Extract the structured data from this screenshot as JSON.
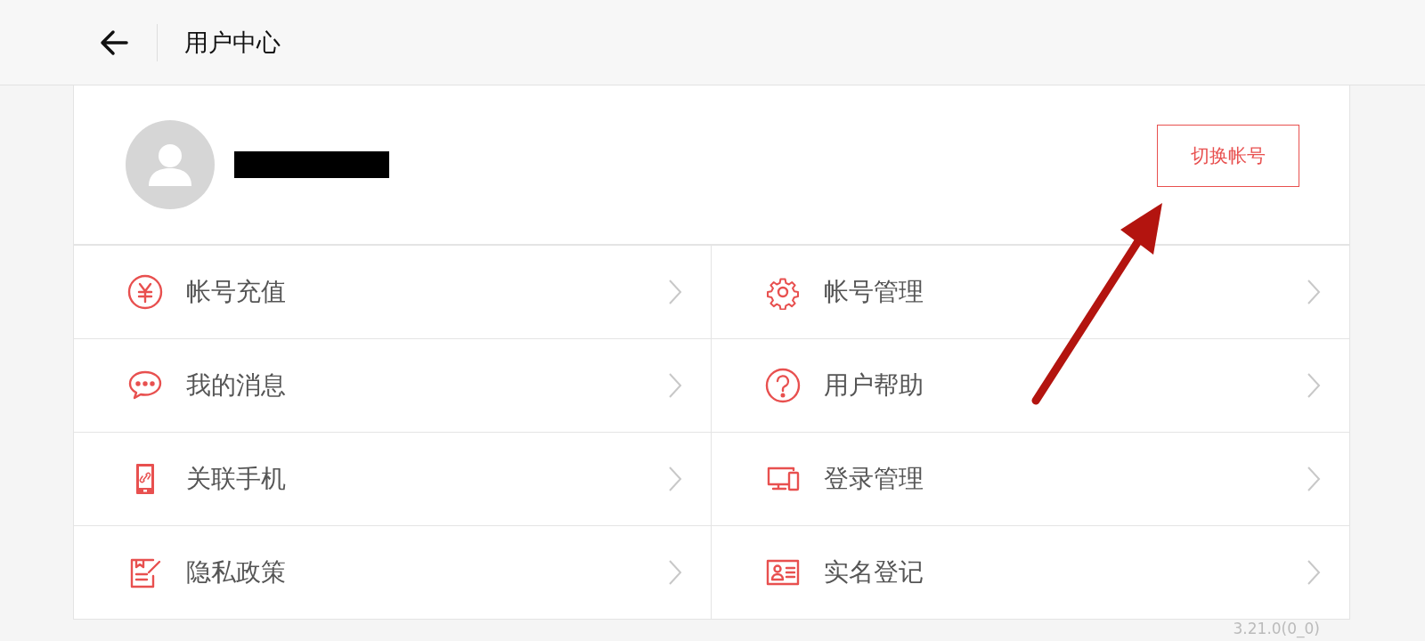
{
  "header": {
    "title": "用户中心"
  },
  "profile": {
    "switch_button": "切换帐号"
  },
  "menu": [
    {
      "label": "帐号充值"
    },
    {
      "label": "帐号管理"
    },
    {
      "label": "我的消息"
    },
    {
      "label": "用户帮助"
    },
    {
      "label": "关联手机"
    },
    {
      "label": "登录管理"
    },
    {
      "label": "隐私政策"
    },
    {
      "label": "实名登记"
    }
  ],
  "version": "3.21.0(0_0)"
}
